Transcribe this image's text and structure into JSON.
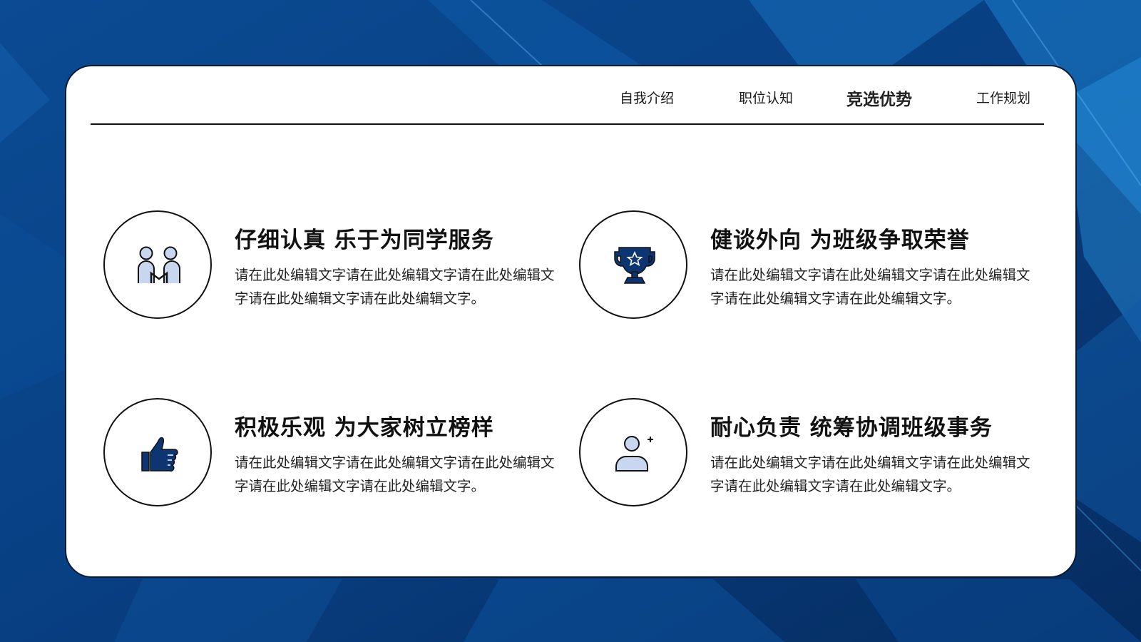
{
  "nav": {
    "items": [
      {
        "label": "自我介绍"
      },
      {
        "label": "职位认知"
      },
      {
        "label": "竞选优势"
      },
      {
        "label": "工作规划"
      }
    ],
    "active_index": 2
  },
  "features": [
    {
      "icon": "people-icon",
      "title": "仔细认真 乐于为同学服务",
      "desc": "请在此处编辑文字请在此处编辑文字请在此处编辑文字请在此处编辑文字请在此处编辑文字。"
    },
    {
      "icon": "trophy-icon",
      "title": "健谈外向 为班级争取荣誉",
      "desc": "请在此处编辑文字请在此处编辑文字请在此处编辑文字请在此处编辑文字请在此处编辑文字。"
    },
    {
      "icon": "thumbs-up-icon",
      "title": "积极乐观 为大家树立榜样",
      "desc": "请在此处编辑文字请在此处编辑文字请在此处编辑文字请在此处编辑文字请在此处编辑文字。"
    },
    {
      "icon": "add-user-icon",
      "title": "耐心负责 统筹协调班级事务",
      "desc": "请在此处编辑文字请在此处编辑文字请在此处编辑文字请在此处编辑文字请在此处编辑文字。"
    }
  ],
  "colors": {
    "background": "#0a3a78",
    "icon_dark": "#0d3572",
    "icon_light": "#c9d6ef"
  }
}
